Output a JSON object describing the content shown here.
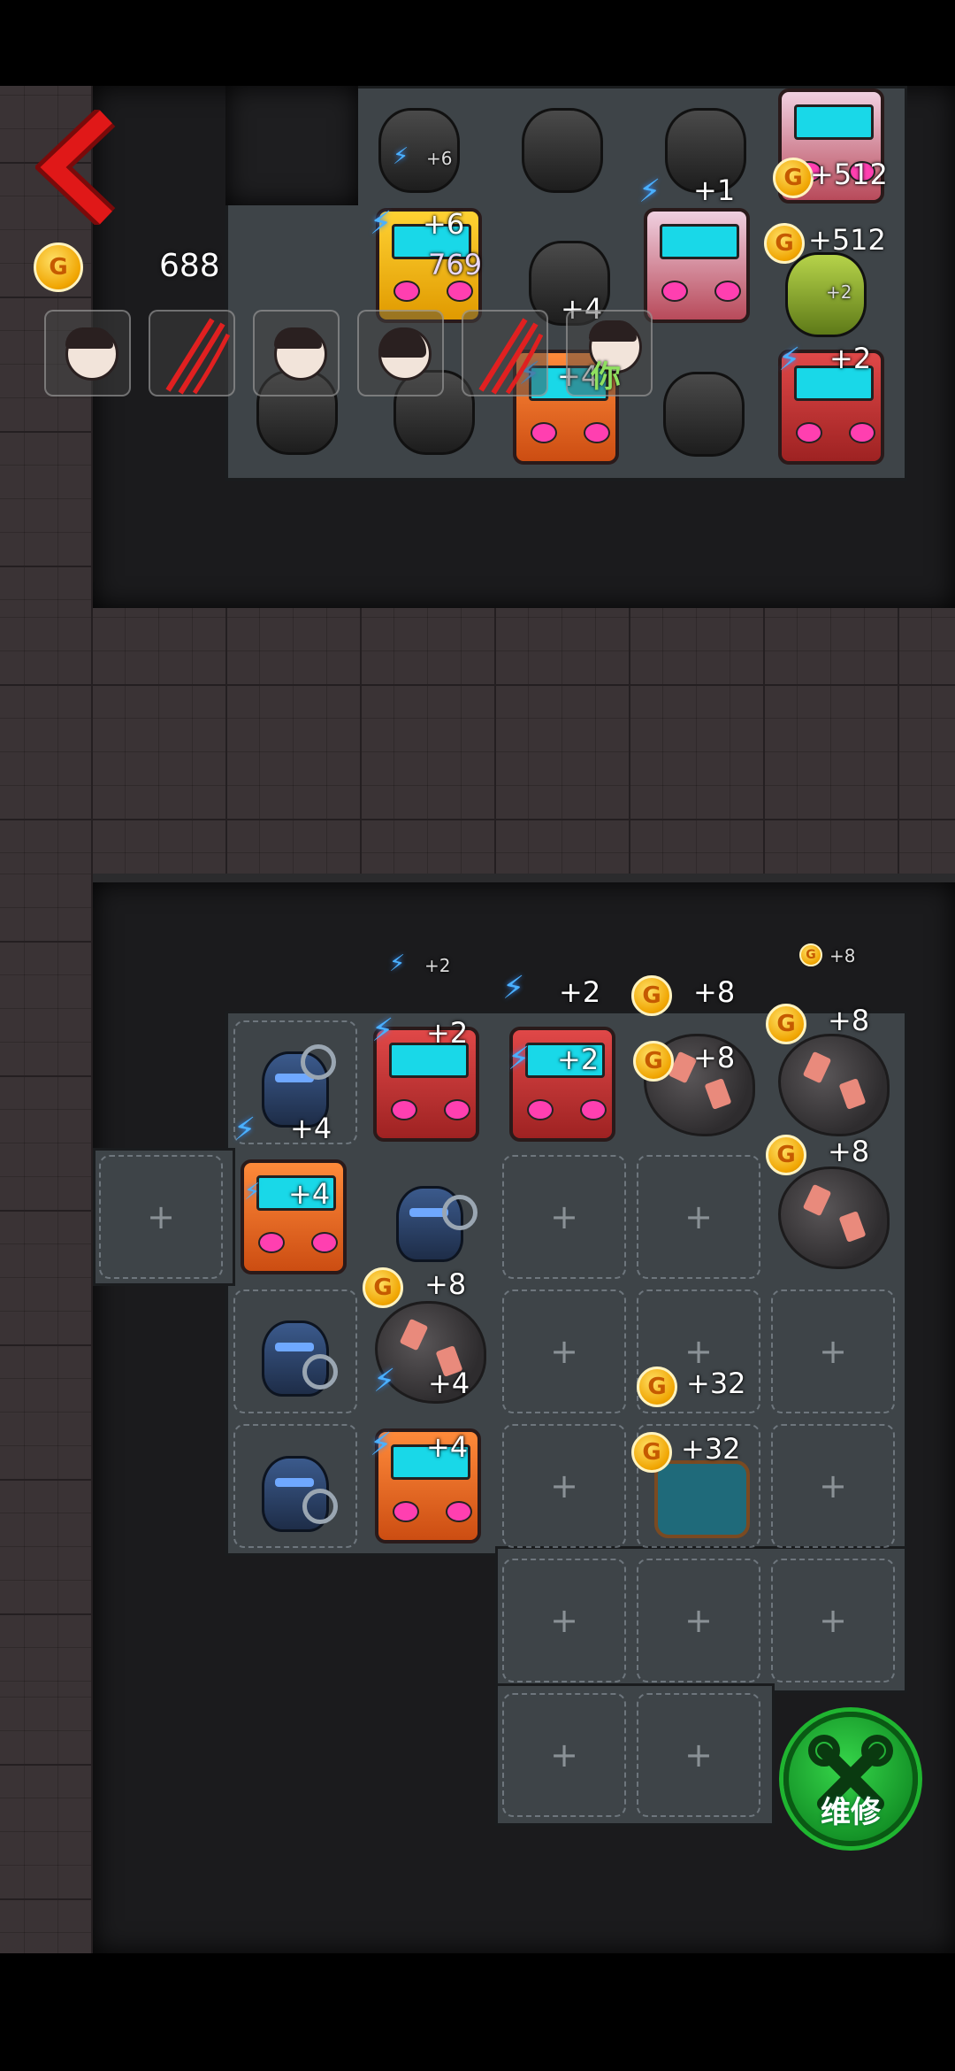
{
  "hud": {
    "gold_amount": "688",
    "back_icon": "chevron-left-icon",
    "you_label": "你",
    "player_slots": [
      "player-girl-icon",
      "claw-scratch-icon",
      "player-bow-girl-icon",
      "player-dark-hair-girl-icon",
      "claw-scratch-icon"
    ]
  },
  "upper_room": {
    "labels": [
      {
        "text": "+6",
        "kind": "energy"
      },
      {
        "text": "+1",
        "kind": "energy"
      },
      {
        "text": "+512",
        "kind": "gold"
      },
      {
        "text": "+6",
        "kind": "energy"
      },
      {
        "text": "769",
        "kind": "plain"
      },
      {
        "text": "+4",
        "kind": "plain"
      },
      {
        "text": "+512",
        "kind": "gold"
      },
      {
        "text": "+2",
        "kind": "plain"
      },
      {
        "text": "+4",
        "kind": "energy"
      },
      {
        "text": "+2",
        "kind": "energy"
      }
    ]
  },
  "lower_room": {
    "float_labels": [
      {
        "text": "+2",
        "kind": "energy"
      },
      {
        "text": "+8",
        "kind": "gold"
      }
    ],
    "labels": [
      {
        "text": "+2",
        "kind": "energy"
      },
      {
        "text": "+2",
        "kind": "energy"
      },
      {
        "text": "+8",
        "kind": "gold"
      },
      {
        "text": "+8",
        "kind": "gold"
      },
      {
        "text": "+2",
        "kind": "energy"
      },
      {
        "text": "+2",
        "kind": "energy"
      },
      {
        "text": "+8",
        "kind": "gold"
      },
      {
        "text": "+8",
        "kind": "gold"
      },
      {
        "text": "+4",
        "kind": "energy"
      },
      {
        "text": "+4",
        "kind": "energy"
      },
      {
        "text": "+8",
        "kind": "gold"
      },
      {
        "text": "+8",
        "kind": "gold"
      },
      {
        "text": "+4",
        "kind": "energy"
      },
      {
        "text": "+32",
        "kind": "gold"
      },
      {
        "text": "+32",
        "kind": "gold"
      },
      {
        "text": "+4",
        "kind": "energy"
      }
    ],
    "empty_tile_symbol": "+"
  },
  "repair_button": {
    "label": "维修",
    "icon": "wrench-gear-icon"
  },
  "colors": {
    "energy": "#4ab0ff",
    "gold": "#f0a400",
    "repair": "#1fb530",
    "back": "#e01818"
  }
}
